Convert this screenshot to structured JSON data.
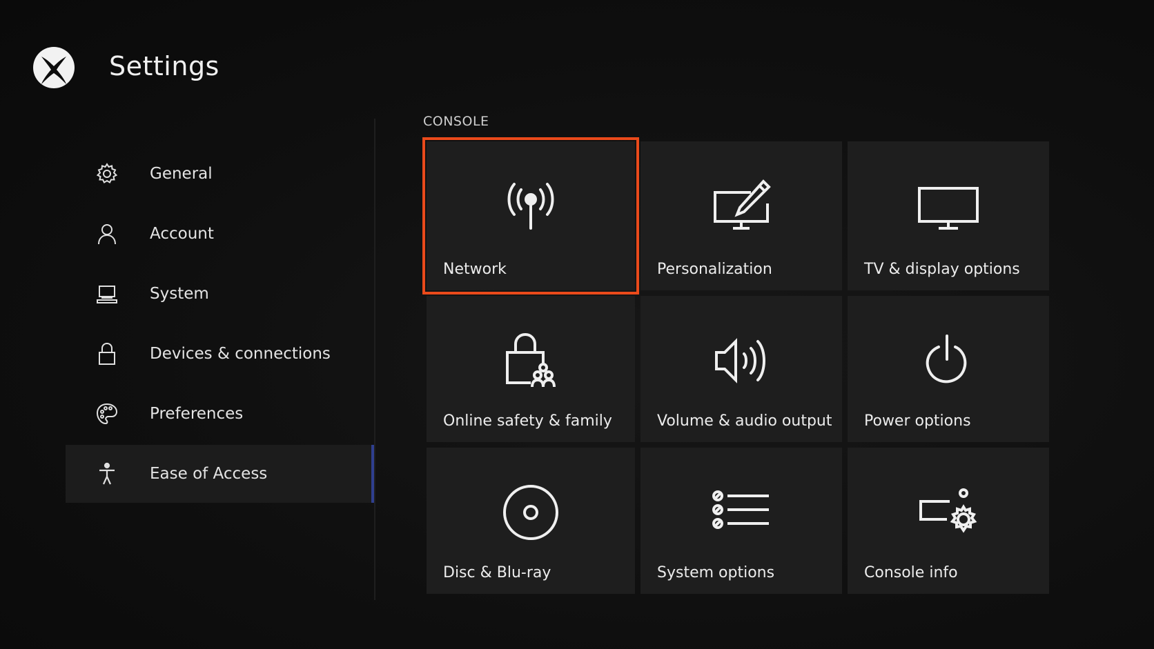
{
  "header": {
    "logo_icon": "xbox-logo-icon",
    "title": "Settings"
  },
  "sidebar": {
    "items": [
      {
        "label": "General",
        "icon": "gear-icon"
      },
      {
        "label": "Account",
        "icon": "person-icon"
      },
      {
        "label": "System",
        "icon": "laptop-icon"
      },
      {
        "label": "Devices & connections",
        "icon": "lock-icon"
      },
      {
        "label": "Preferences",
        "icon": "palette-icon"
      },
      {
        "label": "Ease of Access",
        "icon": "accessibility-icon",
        "selected": true
      }
    ]
  },
  "main": {
    "section_label": "CONSOLE",
    "tiles": [
      {
        "label": "Network",
        "icon": "antenna-icon",
        "selected": true
      },
      {
        "label": "Personalization",
        "icon": "monitor-pen-icon"
      },
      {
        "label": "TV & display options",
        "icon": "monitor-icon"
      },
      {
        "label": "Online safety & family",
        "icon": "lock-family-icon"
      },
      {
        "label": "Volume & audio output",
        "icon": "speaker-icon"
      },
      {
        "label": "Power options",
        "icon": "power-icon"
      },
      {
        "label": "Disc & Blu-ray",
        "icon": "disc-icon"
      },
      {
        "label": "System options",
        "icon": "list-icon"
      },
      {
        "label": "Console info",
        "icon": "console-gear-icon"
      }
    ]
  },
  "colors": {
    "background": "#0d0d0d",
    "tile": "#1e1e1e",
    "focus_outline": "#ea4a1b",
    "selected_bar": "#2f3f8f"
  }
}
